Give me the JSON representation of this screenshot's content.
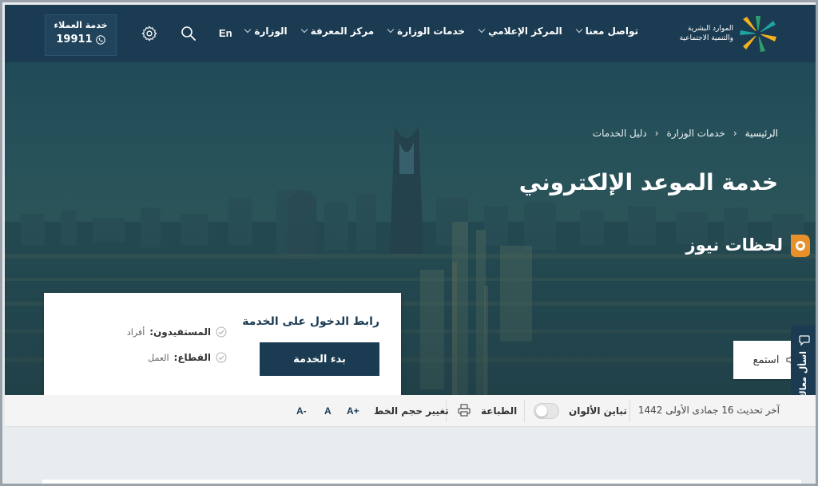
{
  "header": {
    "logo_text_line1": "الموارد البشرية",
    "logo_text_line2": "والتنمية الاجتماعية",
    "nav": [
      {
        "label": "الوزارة"
      },
      {
        "label": "مركز المعرفة"
      },
      {
        "label": "خدمات الوزارة"
      },
      {
        "label": "المركز الإعلامي"
      },
      {
        "label": "تواصل معنا"
      }
    ],
    "lang_label": "En",
    "customer_service_label": "خدمة العملاء",
    "customer_service_number": "19911"
  },
  "breadcrumb": [
    "الرئيسية",
    "خدمات الوزارة",
    "دليل الخدمات"
  ],
  "hero": {
    "title": "خدمة الموعد الإلكتروني",
    "watermark": "لحظات نيوز"
  },
  "service_card": {
    "title": "رابط الدخول على الخدمة",
    "start_button": "بدء الخدمة",
    "beneficiaries_label": "المستفيدون:",
    "beneficiaries_value": "أفراد",
    "sector_label": "القطاع:",
    "sector_value": "العمل"
  },
  "listen_label": "استمع",
  "ask_tab_label": "اسأل معاك",
  "accessibility": {
    "last_update": "آخر تحديث 16 جمادى الأولى 1442",
    "contrast_label": "تباين الألوان",
    "print_label": "الطباعة",
    "font_size_label": "تغيير حجم الخط",
    "font_increase": "A+",
    "font_normal": "A",
    "font_decrease": "A-"
  },
  "colors": {
    "primary": "#1b3b52",
    "logo_green": "#2e9e6b",
    "logo_yellow": "#f2b21c",
    "logo_teal": "#1fa3a0"
  }
}
